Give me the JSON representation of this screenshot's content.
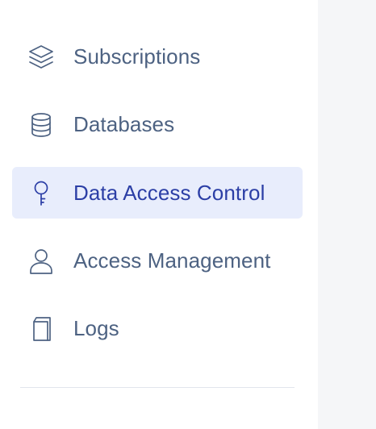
{
  "sidebar": {
    "items": [
      {
        "label": "Subscriptions",
        "icon": "layers-icon",
        "active": false
      },
      {
        "label": "Databases",
        "icon": "database-icon",
        "active": false
      },
      {
        "label": "Data Access Control",
        "icon": "key-icon",
        "active": true
      },
      {
        "label": "Access Management",
        "icon": "user-icon",
        "active": false
      },
      {
        "label": "Logs",
        "icon": "logs-icon",
        "active": false
      }
    ]
  },
  "colors": {
    "text": "#4d6282",
    "active_text": "#2c3fa6",
    "active_bg": "#e8edfc",
    "divider": "#e1e5ec",
    "main_bg": "#f5f6f8"
  }
}
